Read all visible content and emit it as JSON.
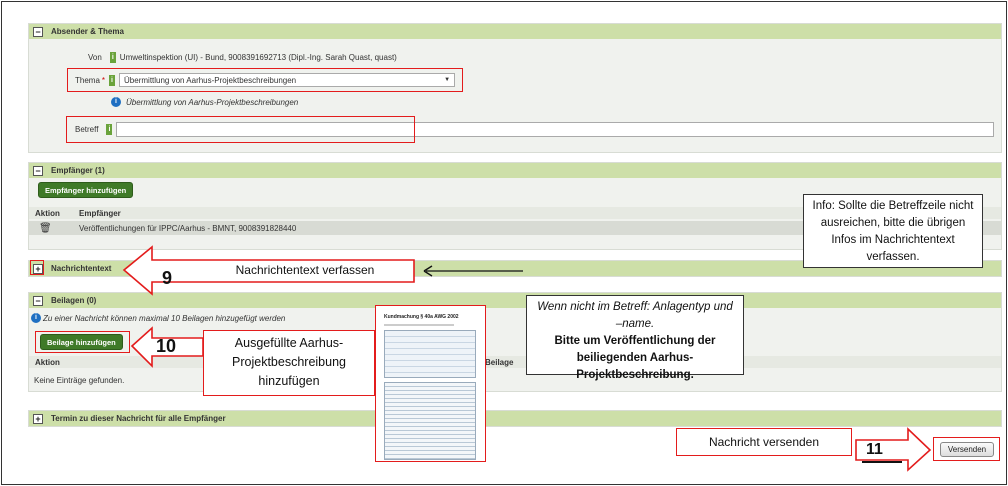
{
  "absender": {
    "title": "Absender & Thema",
    "von_label": "Von",
    "von_value": "Umweltinspektion (UI) - Bund, 9008391692713 (Dipl.-Ing. Sarah Quast, quast)",
    "thema_label": "Thema",
    "thema_value": "Übermittlung von Aarhus-Projektbeschreibungen",
    "thema_hint": "Übermittlung von Aarhus-Projektbeschreibungen",
    "betreff_label": "Betreff",
    "betreff_value": ""
  },
  "empfaenger": {
    "title": "Empfänger (1)",
    "add_button": "Empfänger hinzufügen",
    "col_aktion": "Aktion",
    "col_empfaenger": "Empfänger",
    "rows": [
      "Veröffentlichungen für IPPC/Aarhus - BMNT, 9008391828440"
    ]
  },
  "nachricht": {
    "title": "Nachrichtentext"
  },
  "beilagen": {
    "title": "Beilagen (0)",
    "info": "Zu einer Nachricht können maximal 10 Beilagen hinzugefügt werden",
    "add_button": "Beilage hinzufügen",
    "col_aktion": "Aktion",
    "col_beilage": "Beilage",
    "empty": "Keine Einträge gefunden."
  },
  "termin": {
    "title": "Termin zu dieser Nachricht für alle Empfänger"
  },
  "send_button": "Versenden",
  "annotations": {
    "step9_num": "9",
    "step9_text": "Nachrichtentext verfassen",
    "step10_num": "10",
    "step10_text": "Ausgefüllte Aarhus-Projektbeschreibung hinzufügen",
    "step11_num": "11",
    "step11_text": "Nachricht versenden",
    "info_text": "Info: Sollte die Betreffzeile nicht ausreichen, bitte die übrigen Infos im Nachrichtentext verfassen.",
    "betreff_hint_italic": "Wenn nicht im Betreff: Anlagentyp und –name.",
    "betreff_hint_bold": "Bitte um Veröffentlichung der beiliegenden Aarhus-Projektbeschreibung."
  },
  "document_thumb": {
    "title": "Kundmachung § 40a AWG 2002"
  },
  "colors": {
    "accent_green": "#3f7a28",
    "header_green": "#cddfa8",
    "annotation_red": "#e31c1c"
  }
}
